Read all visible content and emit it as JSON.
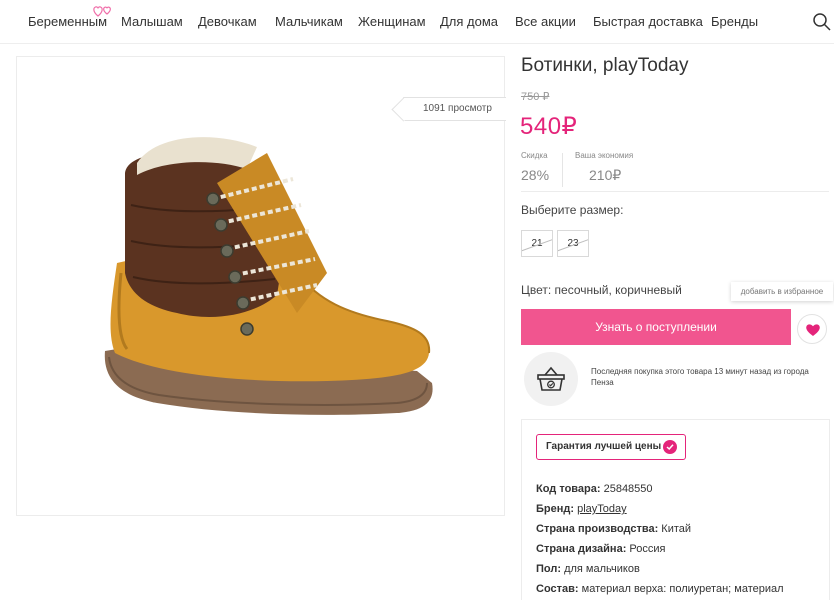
{
  "nav": {
    "items": [
      "Беременным",
      "Малышам",
      "Девочкам",
      "Мальчикам",
      "Женщинам",
      "Для дома",
      "Все акции",
      "Быстрая доставка",
      "Бренды"
    ]
  },
  "product": {
    "views": "1091 просмотр",
    "title": "Ботинки, playToday",
    "old_price": "750 ₽",
    "price": "540₽",
    "discount_label": "Скидка",
    "discount_value": "28%",
    "savings_label": "Ваша экономия",
    "savings_value": "210₽",
    "size_label": "Выберите размер:",
    "sizes": [
      "21",
      "23"
    ],
    "color_line": "Цвет: песочный, коричневый",
    "fav_tooltip": "добавить в избранное",
    "notify_button": "Узнать о поступлении",
    "last_purchase": "Последняя покупка этого товара 13 минут назад из города Пенза",
    "guarantee": "Гарантия лучшей цены"
  },
  "specs": [
    {
      "label": "Код товара:",
      "value": " 25848550"
    },
    {
      "label": "Бренд:",
      "value": "playToday"
    },
    {
      "label": "Страна производства:",
      "value": " Китай"
    },
    {
      "label": "Страна дизайна:",
      "value": " Россия"
    },
    {
      "label": "Пол:",
      "value": " для мальчиков"
    },
    {
      "label": "Состав:",
      "value": " материал верха: полиуретан; материал"
    }
  ],
  "colors": {
    "accent": "#e4247a",
    "button": "#f1558f"
  },
  "icons": {
    "search": "search-icon",
    "heart": "heart-icon",
    "basket": "basket-icon",
    "check": "check-icon"
  }
}
